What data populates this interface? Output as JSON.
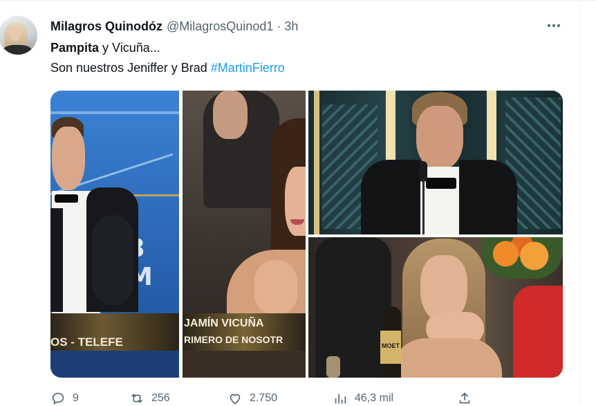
{
  "author": {
    "name": "Milagros Quinodóz",
    "handle": "@MilagrosQuinod1",
    "separator": "·",
    "time": "3h"
  },
  "tweet": {
    "line1_bold": "Pampita",
    "line1_rest": " y Vicuña...",
    "line2_text": "Son nuestros Jeniffer y Brad ",
    "hashtag": "#MartinFierro"
  },
  "media": {
    "panel1": {
      "lower_third_text": "OS - TELEFE",
      "wall_text": "3 M"
    },
    "panel2": {
      "lower_third_line1": "JAMÍN VICUÑA",
      "lower_third_line2": "RIMERO DE NOSOTR"
    },
    "panel4": {
      "bottle_text": "MOET"
    }
  },
  "actions": {
    "reply_count": "9",
    "retweet_count": "256",
    "like_count": "2.750",
    "views_count": "46,3 mil"
  },
  "icons": [
    "avatar",
    "more-icon",
    "reply-icon",
    "retweet-icon",
    "like-icon",
    "views-icon",
    "share-icon"
  ],
  "colors": {
    "link": "#1d9bf0",
    "secondary_text": "#536471",
    "text": "#0f1419"
  }
}
